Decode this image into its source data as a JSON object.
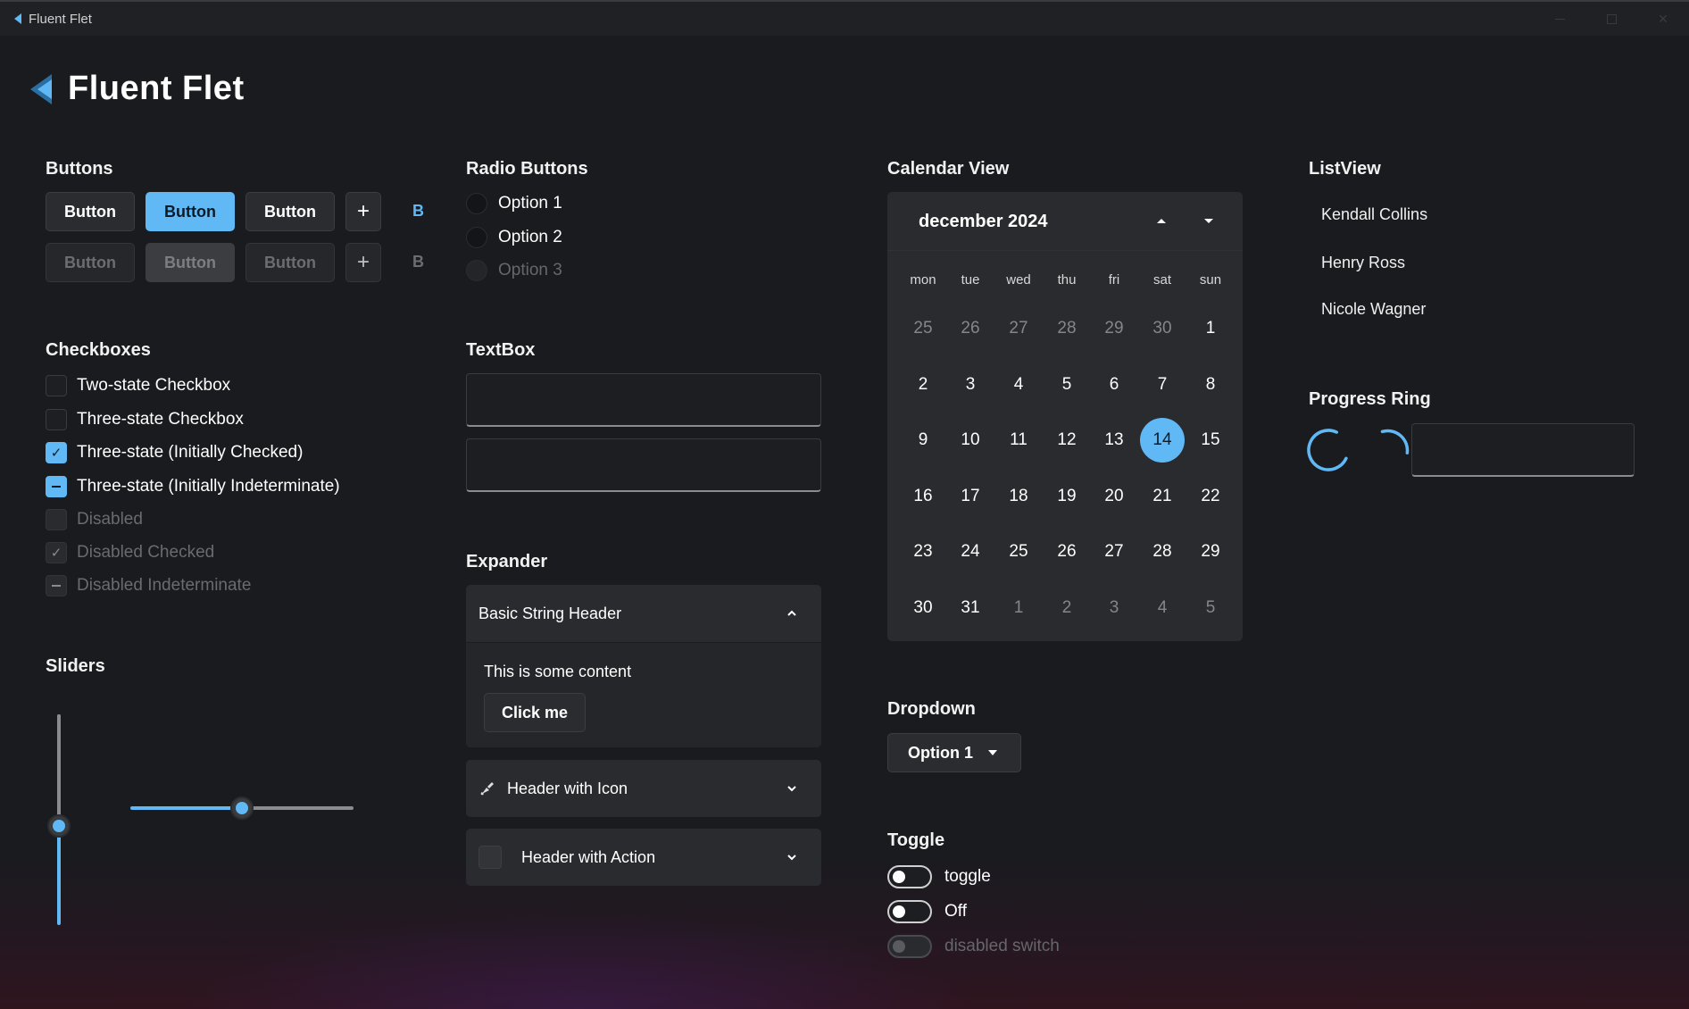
{
  "window": {
    "title": "Fluent Flet"
  },
  "app": {
    "title": "Fluent Flet"
  },
  "colors": {
    "accent": "#60b8f5",
    "background": "#1a1b1f",
    "surface": "#2a2b2f"
  },
  "buttons": {
    "title": "Buttons",
    "row1": {
      "standard": "Button",
      "primary": "Button",
      "secondary": "Button",
      "icon": "+",
      "link": "B"
    },
    "row2": {
      "standard": "Button",
      "primary": "Button",
      "secondary": "Button",
      "icon": "+",
      "link": "B"
    }
  },
  "radio": {
    "title": "Radio Buttons",
    "options": [
      "Option 1",
      "Option 2",
      "Option 3"
    ]
  },
  "checkboxes": {
    "title": "Checkboxes",
    "items": [
      "Two-state Checkbox",
      "Three-state Checkbox",
      "Three-state (Initially Checked)",
      "Three-state (Initially Indeterminate)",
      "Disabled",
      "Disabled Checked",
      "Disabled Indeterminate"
    ]
  },
  "sliders": {
    "title": "Sliders",
    "vertical_value": 0.47,
    "horizontal_value": 0.5
  },
  "textbox": {
    "title": "TextBox",
    "value1": "",
    "value2": ""
  },
  "expander": {
    "title": "Expander",
    "items": [
      {
        "header": "Basic String Header",
        "content": "This is some content",
        "button": "Click me"
      },
      {
        "header": "Header with Icon"
      },
      {
        "header": "Header with Action"
      }
    ]
  },
  "calendar": {
    "title": "Calendar View",
    "month": "december 2024",
    "weekdays": [
      "mon",
      "tue",
      "wed",
      "thu",
      "fri",
      "sat",
      "sun"
    ],
    "weeks": [
      [
        "25",
        "26",
        "27",
        "28",
        "29",
        "30",
        "1"
      ],
      [
        "2",
        "3",
        "4",
        "5",
        "6",
        "7",
        "8"
      ],
      [
        "9",
        "10",
        "11",
        "12",
        "13",
        "14",
        "15"
      ],
      [
        "16",
        "17",
        "18",
        "19",
        "20",
        "21",
        "22"
      ],
      [
        "23",
        "24",
        "25",
        "26",
        "27",
        "28",
        "29"
      ],
      [
        "30",
        "31",
        "1",
        "2",
        "3",
        "4",
        "5"
      ]
    ],
    "selected": "14"
  },
  "dropdown": {
    "title": "Dropdown",
    "selected": "Option 1"
  },
  "toggle": {
    "title": "Toggle",
    "items": [
      "toggle",
      "Off",
      "disabled switch"
    ]
  },
  "listview": {
    "title": "ListView",
    "items": [
      "Kendall Collins",
      "Henry Ross",
      "Nicole Wagner"
    ]
  },
  "progress": {
    "title": "Progress Ring"
  }
}
